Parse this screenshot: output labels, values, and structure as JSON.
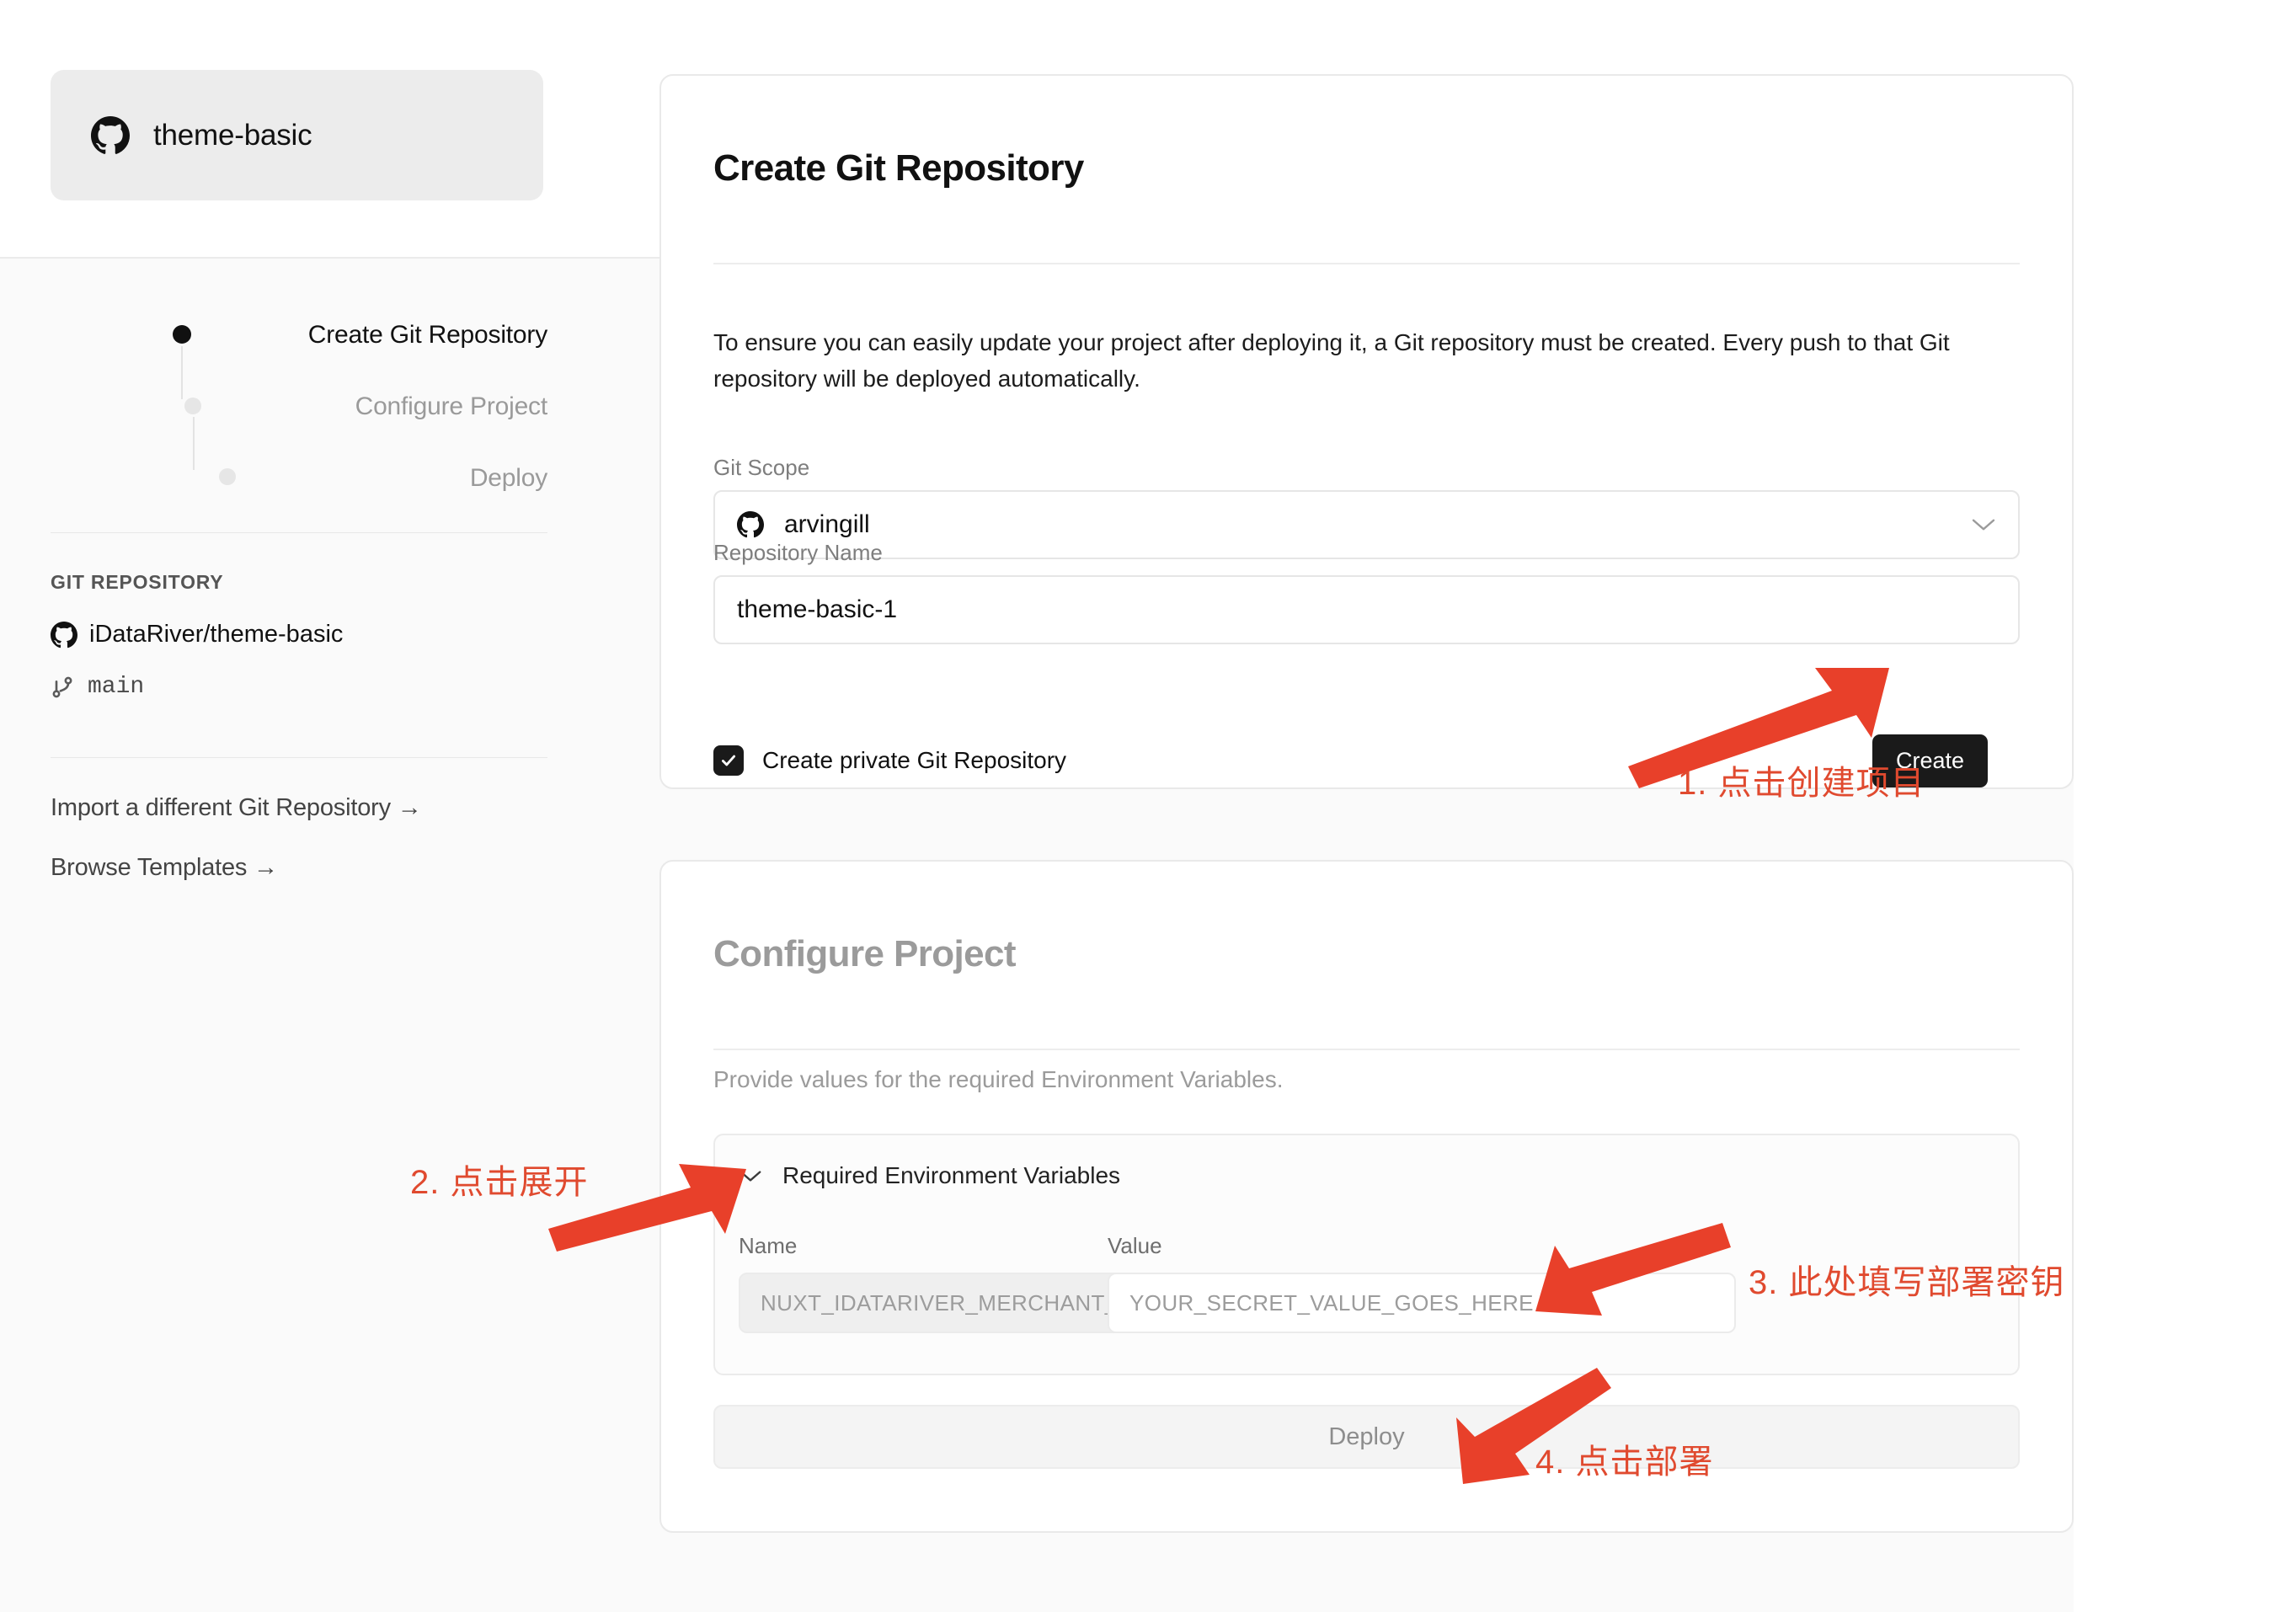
{
  "sidebar": {
    "repo_chip": {
      "label": "theme-basic",
      "icon": "github-icon"
    },
    "steps": [
      {
        "label": "Create Git Repository",
        "state": "active"
      },
      {
        "label": "Configure Project",
        "state": "pending"
      },
      {
        "label": "Deploy",
        "state": "pending"
      }
    ],
    "git_repository": {
      "caption": "GIT REPOSITORY",
      "path": "iDataRiver/theme-basic",
      "branch": "main",
      "path_icon": "github-icon",
      "branch_icon": "git-branch-icon"
    },
    "links": [
      {
        "label": "Import a different Git Repository →"
      },
      {
        "label": "Browse Templates →"
      }
    ]
  },
  "create_repo_card": {
    "title": "Create Git Repository",
    "description": "To ensure you can easily update your project after deploying it, a Git repository must be created. Every push to that Git repository will be deployed automatically.",
    "git_scope": {
      "label": "Git Scope",
      "value": "arvingill",
      "icon": "github-icon",
      "chevron": "chevron-down-icon"
    },
    "repository_name": {
      "label": "Repository Name",
      "value": "theme-basic-1"
    },
    "private_checkbox": {
      "label": "Create private Git Repository",
      "checked": true
    },
    "create_button": "Create"
  },
  "configure_card": {
    "title": "Configure Project",
    "description": "Provide values for the required Environment Variables.",
    "env_section": {
      "header": "Required Environment Variables",
      "chevron": "chevron-down-icon",
      "columns": {
        "name": "Name",
        "value": "Value"
      },
      "rows": [
        {
          "name": "NUXT_IDATARIVER_MERCHANT_SECRET",
          "value_placeholder": "YOUR_SECRET_VALUE_GOES_HERE"
        }
      ]
    },
    "deploy_button": "Deploy"
  },
  "annotations": {
    "color": "#e04a2f",
    "items": [
      {
        "text": "1. 点击创建项目"
      },
      {
        "text": "2. 点击展开"
      },
      {
        "text": "3. 此处填写部署密钥"
      },
      {
        "text": "4. 点击部署"
      }
    ]
  }
}
